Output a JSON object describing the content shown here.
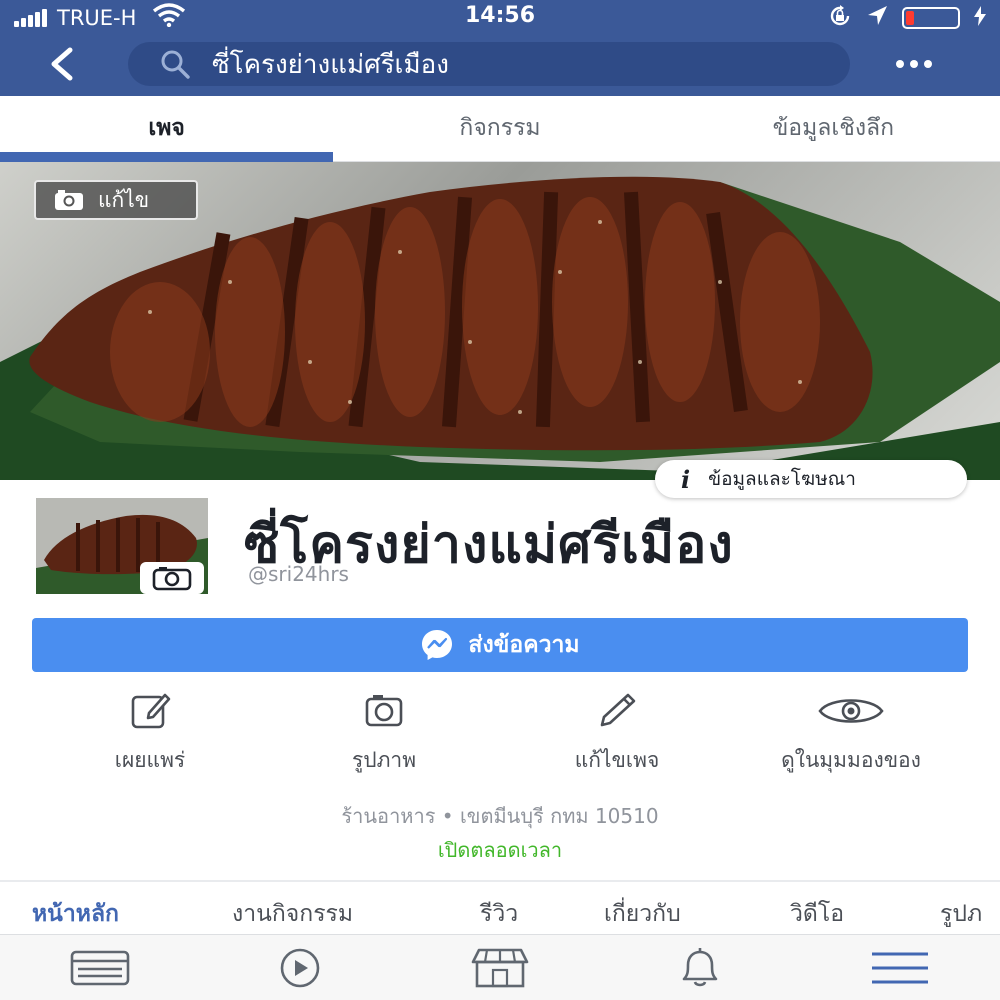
{
  "status_bar": {
    "carrier": "TRUE-H",
    "time": "14:56",
    "battery_level": 0.15,
    "icons": [
      "signal-icon",
      "wifi-icon",
      "orientation-lock-icon",
      "location-arrow-icon",
      "battery-icon",
      "charging-bolt-icon"
    ]
  },
  "nav": {
    "search_text": "ซี่โครงย่างแม่ศรีเมือง",
    "icons": [
      "back-icon",
      "search-icon",
      "more-icon"
    ]
  },
  "top_tabs": {
    "items": [
      {
        "label": "เพจ",
        "active": true
      },
      {
        "label": "กิจกรรม",
        "active": false
      },
      {
        "label": "ข้อมูลเชิงลึก",
        "active": false
      }
    ]
  },
  "cover": {
    "edit_label": "แก้ไข",
    "info_ads_label": "ข้อมูลและโฆษณา"
  },
  "profile": {
    "name": "ซี่โครงย่างแม่ศรีเมือง",
    "handle": "@sri24hrs"
  },
  "message_button": {
    "label": "ส่งข้อความ"
  },
  "actions": [
    {
      "label": "เผยแพร่",
      "icon": "compose-icon"
    },
    {
      "label": "รูปภาพ",
      "icon": "camera-icon"
    },
    {
      "label": "แก้ไขเพจ",
      "icon": "pencil-icon"
    },
    {
      "label": "ดูในมุมมองของ",
      "icon": "eye-icon"
    }
  ],
  "info": {
    "category_location": "ร้านอาหาร • เขตมีนบุรี กทม 10510",
    "hours": "เปิดตลอดเวลา"
  },
  "section_tabs": [
    {
      "label": "หน้าหลัก",
      "active": true
    },
    {
      "label": "งานกิจกรรม",
      "active": false
    },
    {
      "label": "รีวิว",
      "active": false
    },
    {
      "label": "เกี่ยวกับ",
      "active": false
    },
    {
      "label": "วิดีโอ",
      "active": false
    },
    {
      "label": "รูปภ",
      "active": false
    }
  ],
  "bottom_bar": {
    "items": [
      "news-feed-icon",
      "video-play-icon",
      "marketplace-icon",
      "notifications-bell-icon",
      "menu-icon"
    ],
    "active_index": 4
  },
  "colors": {
    "facebook_blue": "#3b5998",
    "accent_blue": "#4267b2",
    "message_button_blue": "#4a8ef0",
    "open_green": "#42b72a",
    "battery_red": "#ff3b30"
  }
}
